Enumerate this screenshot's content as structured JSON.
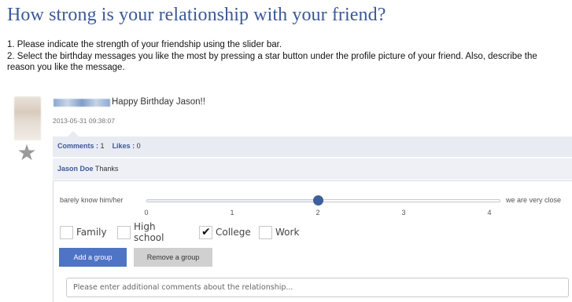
{
  "title": "How strong is your relationship with your friend?",
  "instructions": [
    "1. Please indicate the strength of your friendship using the slider bar.",
    "2. Select the birthday messages you like the most by pressing a star button under the profile picture of your friend. Also, describe the reason you like the message."
  ],
  "post": {
    "message": "Happy Birthday Jason!!",
    "timestamp": "2013-05-31 09:38:07",
    "star_icon": "star-icon",
    "comments_label": "Comments :",
    "comments_count": "1",
    "likes_label": "Likes :",
    "likes_count": "0",
    "comment": {
      "author": "Jason Doe",
      "text": "Thanks"
    }
  },
  "slider": {
    "left_label": "barely know him/her",
    "right_label": "we are very close",
    "ticks": [
      "0",
      "1",
      "2",
      "3",
      "4"
    ],
    "min": 0,
    "max": 4,
    "value": 2
  },
  "groups": [
    {
      "label": "Family",
      "checked": false
    },
    {
      "label": "High school",
      "checked": false
    },
    {
      "label": "College",
      "checked": true
    },
    {
      "label": "Work",
      "checked": false
    }
  ],
  "buttons": {
    "add": "Add a group",
    "remove": "Remove a group"
  },
  "comments_field": {
    "placeholder": "Please enter additional comments about the relationship...",
    "value": ""
  },
  "colors": {
    "title": "#3b5998",
    "accent": "#4f74c5",
    "slider_thumb": "#3e5f9e",
    "bar_bg": "#e9ebf3"
  }
}
